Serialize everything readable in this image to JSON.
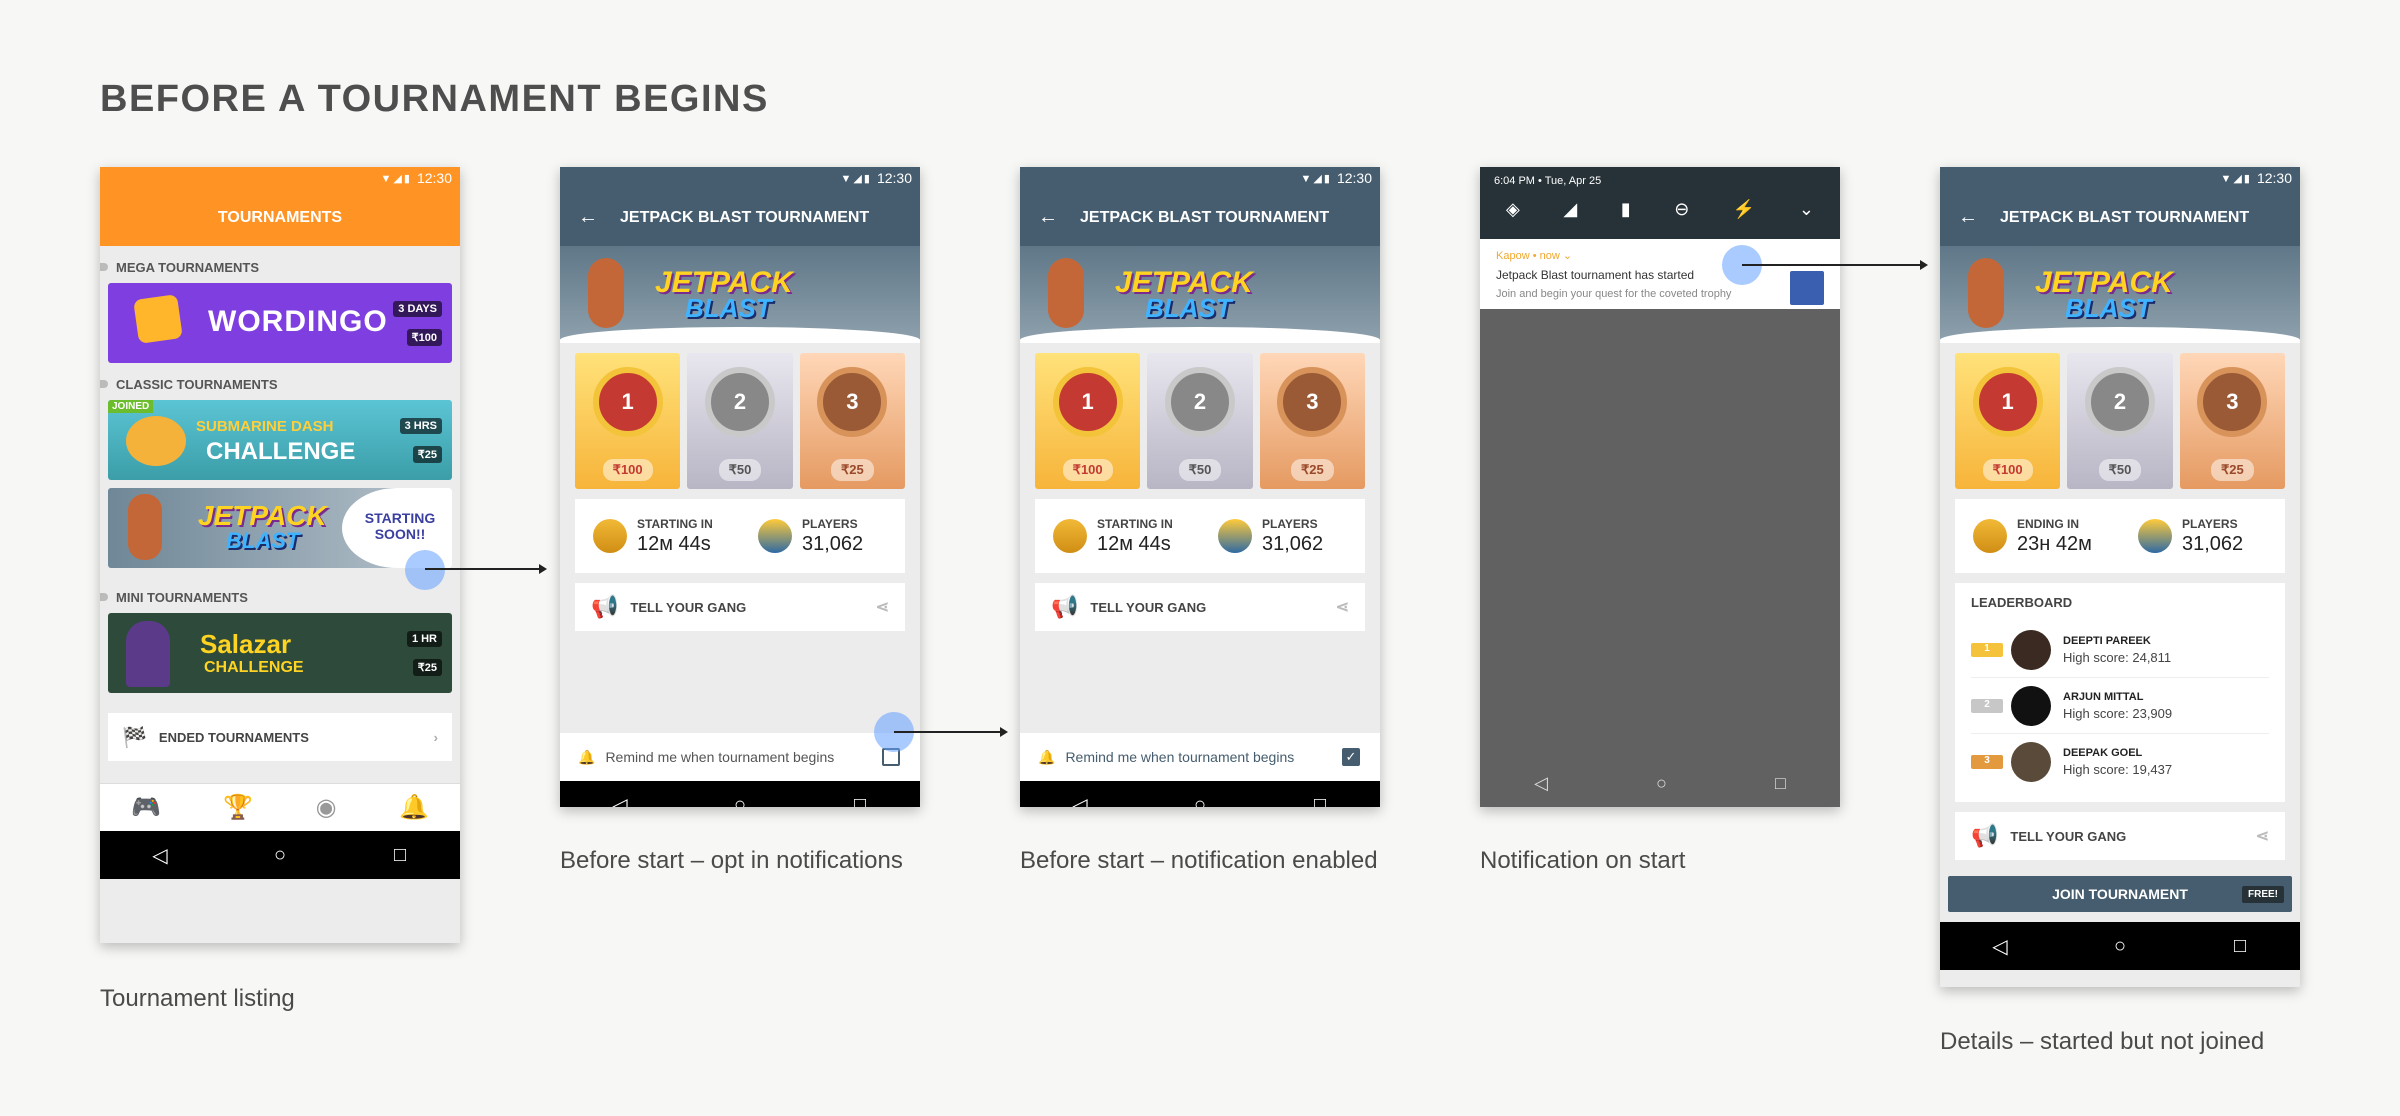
{
  "page_title": "BEFORE A TOURNAMENT BEGINS",
  "time": "12:30",
  "captions": {
    "listing": "Tournament listing",
    "opt_in": "Before start – opt in notifications",
    "enabled": "Before start – notification enabled",
    "notif": "Notification on start",
    "details": "Details – started but not joined"
  },
  "listing": {
    "header": "TOURNAMENTS",
    "mega_section": "MEGA TOURNAMENTS",
    "classic_section": "CLASSIC TOURNAMENTS",
    "mini_section": "MINI TOURNAMENTS",
    "wordingo": {
      "name": "WORDINGO",
      "time": "3 DAYS",
      "prize": "₹100"
    },
    "submarine": {
      "joined": "JOINED",
      "name1": "SUBMARINE DASH",
      "name2": "CHALLENGE",
      "time": "3 HRS",
      "prize": "₹25"
    },
    "jetpack": {
      "name1": "JETPACK",
      "name2": "BLAST",
      "soon": "STARTING SOON!!"
    },
    "salazar": {
      "name1": "Salazar",
      "name2": "CHALLENGE",
      "time": "1 HR",
      "prize": "₹25"
    },
    "ended": "ENDED TOURNAMENTS"
  },
  "detail": {
    "title": "JETPACK BLAST TOURNAMENT",
    "logo1": "JETPACK",
    "logo2": "BLAST",
    "prizes": [
      "₹100",
      "₹50",
      "₹25"
    ],
    "ranks": [
      "1",
      "2",
      "3"
    ],
    "starting_label": "STARTING IN",
    "starting_value": "12м 44s",
    "ending_label": "ENDING IN",
    "ending_value": "23н 42м",
    "players_label": "PLAYERS",
    "players_value": "31,062",
    "share": "TELL YOUR GANG",
    "remind": "Remind me when tournament begins",
    "check": "✓"
  },
  "notif": {
    "datetime": "6:04 PM • Tue, Apr 25",
    "app": "Kapow • now ⌄",
    "title": "Jetpack Blast tournament has started",
    "body": "Join and begin your quest for the coveted trophy"
  },
  "leaderboard": {
    "title": "LEADERBOARD",
    "rows": [
      {
        "rank": "1",
        "name": "DEEPTI PAREEK",
        "score": "High score: 24,811",
        "color": "#f5c33b"
      },
      {
        "rank": "2",
        "name": "ARJUN MITTAL",
        "score": "High score: 23,909",
        "color": "#c7c7c7"
      },
      {
        "rank": "3",
        "name": "DEEPAK GOEL",
        "score": "High score: 19,437",
        "color": "#e39a3f"
      }
    ]
  },
  "join": {
    "label": "JOIN TOURNAMENT",
    "free": "FREE!"
  }
}
